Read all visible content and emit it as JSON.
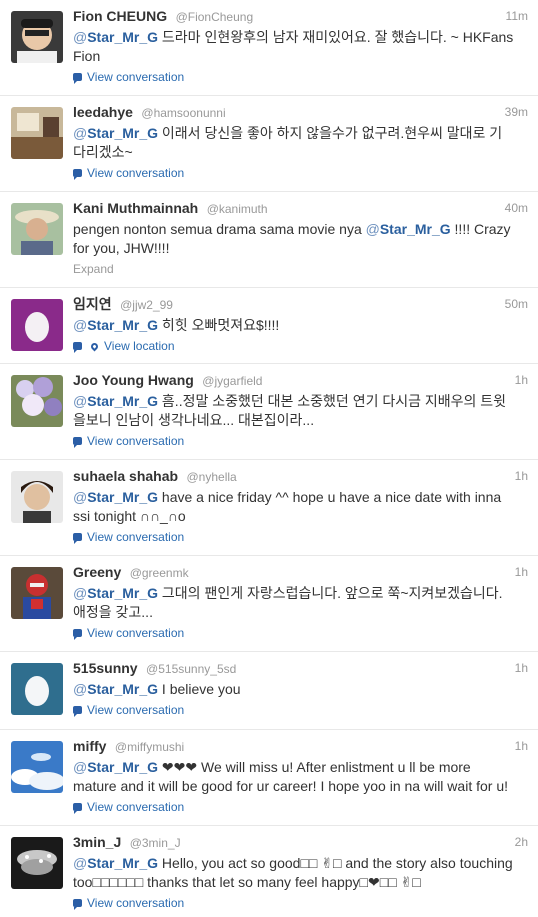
{
  "tweets": [
    {
      "fullname": "Fion CHEUNG",
      "username": "@FionCheung",
      "time": "11m",
      "mention": "Star_Mr_G",
      "text": " 드라마 인현왕후의 남자 재미있어요. 잘 했습니다. ~ HKFans Fion",
      "action": "View conversation",
      "avatar": "child-photo-avatar"
    },
    {
      "fullname": "leedahye",
      "username": "@hamsoonunni",
      "time": "39m",
      "mention": "Star_Mr_G",
      "text": " 이래서 당신을 좋아 하지 않을수가 없구려.현우씨 말대로 기다리겠소~",
      "action": "View conversation",
      "avatar": "room-photo-avatar"
    },
    {
      "fullname": "Kani Muthmainnah",
      "username": "@kanimuth",
      "time": "40m",
      "prefix": "pengen nonton semua drama sama movie nya ",
      "mention": "Star_Mr_G",
      "text": " !!!! Crazy for you, JHW!!!!",
      "action": "Expand",
      "avatar": "hat-photo-avatar"
    },
    {
      "fullname": "임지연",
      "username": "@jjw2_99",
      "time": "50m",
      "mention": "Star_Mr_G",
      "text": " 히힛 오빠멋져요$!!!!",
      "action": "View location",
      "avatar": "egg-avatar-purple"
    },
    {
      "fullname": "Joo Young Hwang",
      "username": "@jygarfield",
      "time": "1h",
      "mention": "Star_Mr_G",
      "text": " 흠..정말 소중했던 대본 소중했던 연기 다시금 지배우의 트윗을보니 인남이 생각나네요... 대본집이라...",
      "action": "View conversation",
      "avatar": "flowers-photo-avatar"
    },
    {
      "fullname": "suhaela shahab",
      "username": "@nyhella",
      "time": "1h",
      "mention": "Star_Mr_G",
      "text": " have a nice friday ^^ hope u have a nice date with inna ssi tonight ∩∩_∩o",
      "action": "View conversation",
      "avatar": "portrait-photo-avatar"
    },
    {
      "fullname": "Greeny",
      "username": "@greenmk",
      "time": "1h",
      "mention": "Star_Mr_G",
      "text": " 그대의 팬인게 자랑스럽습니다. 앞으로 쭉~지켜보겠습니다.애정을 갖고...",
      "action": "View conversation",
      "avatar": "hero-figure-avatar"
    },
    {
      "fullname": "515sunny",
      "username": "@515sunny_5sd",
      "time": "1h",
      "mention": "Star_Mr_G",
      "text": " I believe you",
      "action": "View conversation",
      "avatar": "egg-avatar-teal"
    },
    {
      "fullname": "miffy",
      "username": "@miffymushi",
      "time": "1h",
      "mention": "Star_Mr_G",
      "text": " ❤❤❤ We will miss u! After enlistment u ll be more mature and it will be good for ur career! I hope yoo in na will wait for u!",
      "action": "View conversation",
      "avatar": "sky-photo-avatar"
    },
    {
      "fullname": "3min_J",
      "username": "@3min_J",
      "time": "2h",
      "mention": "Star_Mr_G",
      "text": " Hello, you act so good□□ ✌□ and the story also touching too□□□□□□ thanks that let so many feel happy□❤□□ ✌□",
      "action": "View conversation",
      "avatar": "chandelier-photo-avatar"
    }
  ]
}
